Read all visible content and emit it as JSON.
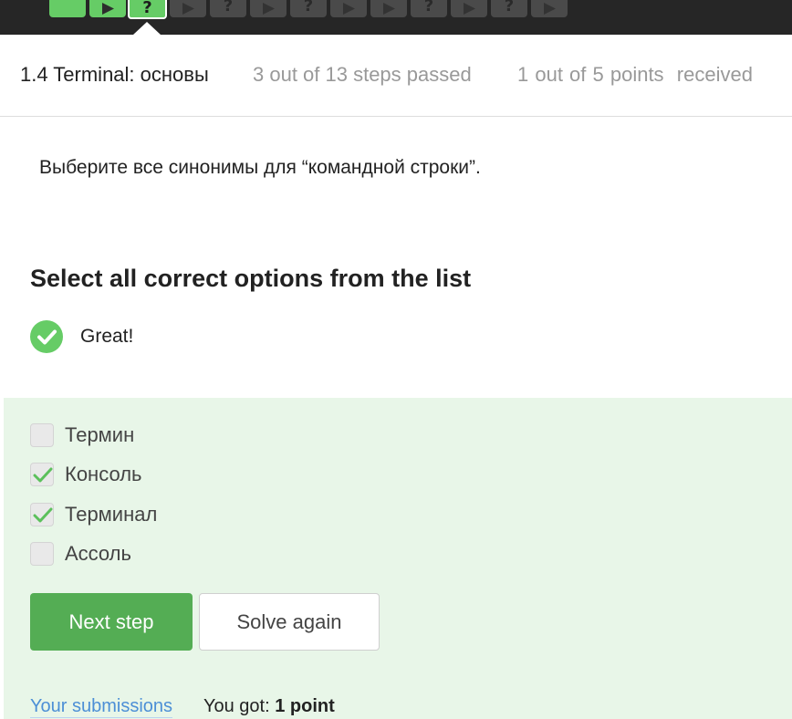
{
  "step_bar": {
    "steps": [
      {
        "kind": "text",
        "state": "done"
      },
      {
        "kind": "video",
        "state": "done"
      },
      {
        "kind": "quiz",
        "state": "current",
        "symbol": "?"
      },
      {
        "kind": "video",
        "state": "pending"
      },
      {
        "kind": "quiz",
        "state": "pending",
        "symbol": "?"
      },
      {
        "kind": "video",
        "state": "pending"
      },
      {
        "kind": "quiz",
        "state": "pending",
        "symbol": "?"
      },
      {
        "kind": "video",
        "state": "pending"
      },
      {
        "kind": "video",
        "state": "pending"
      },
      {
        "kind": "quiz",
        "state": "pending",
        "symbol": "?"
      },
      {
        "kind": "video",
        "state": "pending"
      },
      {
        "kind": "quiz",
        "state": "pending",
        "symbol": "?"
      },
      {
        "kind": "video",
        "state": "pending"
      }
    ]
  },
  "header": {
    "lesson_title": "1.4 Terminal: основы",
    "steps_progress": "3 out of 13 steps passed",
    "points_progress": "1 out of 5 points  received"
  },
  "question_text": "Выберите все синонимы для “командной строки”.",
  "quiz": {
    "title": "Select all correct options from the list",
    "status_text": "Great!",
    "options": [
      {
        "label": "Термин",
        "checked": false
      },
      {
        "label": "Консоль",
        "checked": true
      },
      {
        "label": "Терминал",
        "checked": true
      },
      {
        "label": "Ассоль",
        "checked": false
      }
    ],
    "next_button": "Next step",
    "solve_again_button": "Solve again"
  },
  "footer": {
    "submissions_link": "Your submissions",
    "result_prefix": "You got: ",
    "result_value": "1 point"
  },
  "colors": {
    "success": "#66cc66",
    "panel_bg": "#e8f6e8",
    "primary_button": "#54ad54",
    "link": "#4c8fd6"
  }
}
